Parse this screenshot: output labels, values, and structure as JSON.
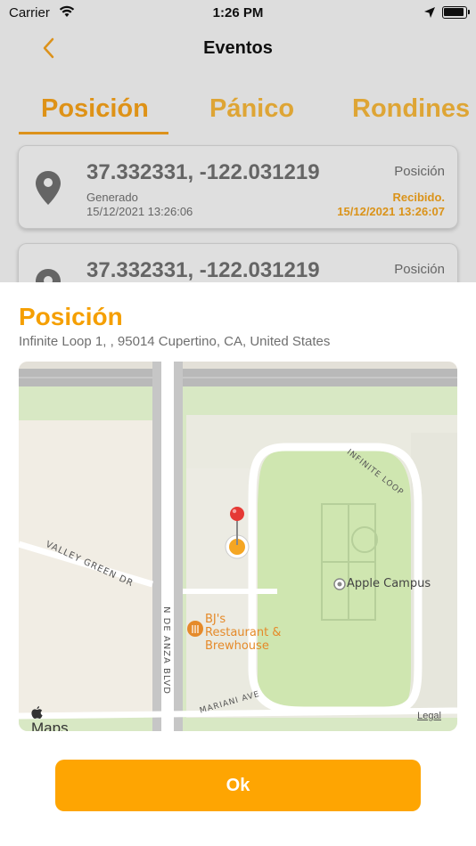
{
  "status_bar": {
    "carrier": "Carrier",
    "time": "1:26 PM"
  },
  "nav": {
    "title": "Eventos",
    "back_icon": "chevron-left-icon"
  },
  "tabs": [
    {
      "label": "Posición",
      "active": true
    },
    {
      "label": "Pánico",
      "active": false
    },
    {
      "label": "Rondines",
      "active": false
    }
  ],
  "events": [
    {
      "coords": "37.332331, -122.031219",
      "type": "Posición",
      "generated_label": "Generado",
      "generated_date": "15/12/2021 13:26:06",
      "received_label": "Recibido.",
      "received_date": "15/12/2021 13:26:07"
    },
    {
      "coords": "37.332331, -122.031219",
      "type": "Posición"
    }
  ],
  "sheet": {
    "title": "Posición",
    "address": "Infinite Loop 1, , 95014 Cupertino, CA, United States",
    "map": {
      "labels": {
        "campus": "Apple Campus",
        "bj_line1": "BJ's",
        "bj_line2": "Restaurant &",
        "bj_line3": "Brewhouse",
        "valley": "VALLEY GREEN DR",
        "deanza": "N DE ANZA BLVD",
        "infinite": "INFINITE LOOP",
        "mariani": "MARIANI AVE"
      },
      "logo": "Maps",
      "legal": "Legal"
    },
    "ok_label": "Ok"
  },
  "colors": {
    "accent": "#f59f00",
    "button": "#fea502",
    "tab_underline": "#f2a11e"
  }
}
